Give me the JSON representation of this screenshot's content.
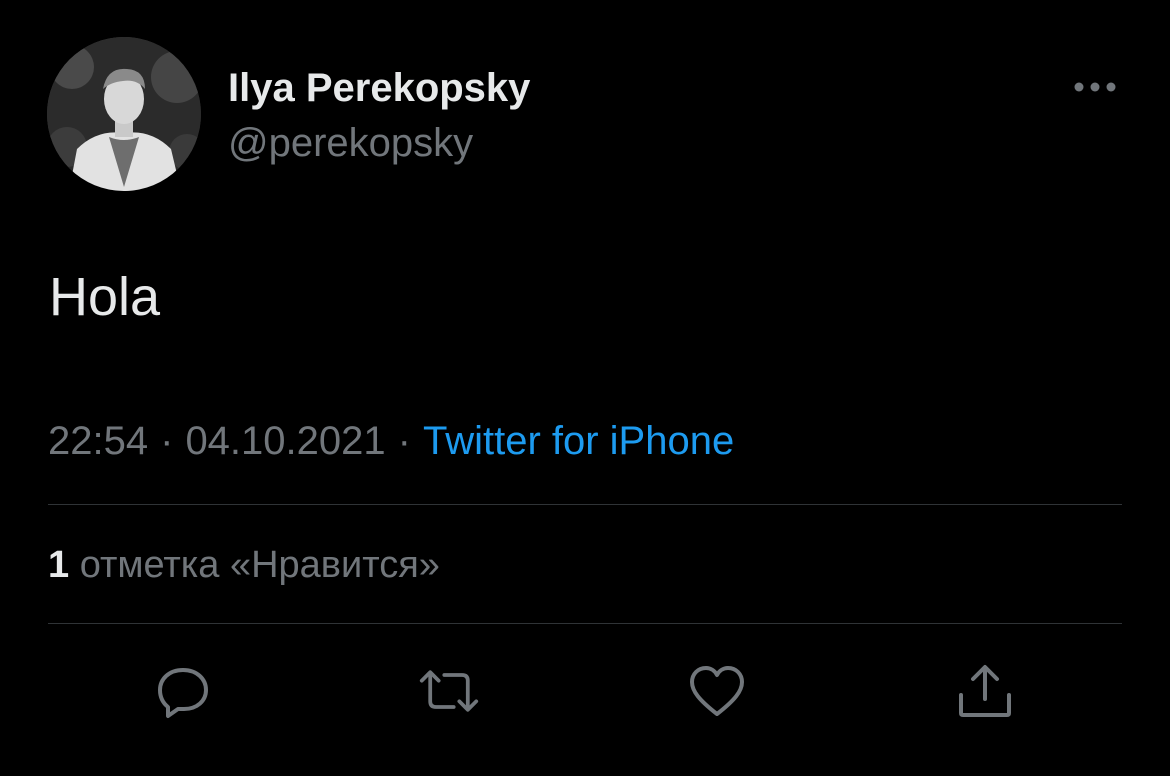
{
  "author": {
    "name": "Ilya Perekopsky",
    "handle": "@perekopsky"
  },
  "tweet": {
    "text": "Hola",
    "time": "22:54",
    "date": "04.10.2021",
    "separator": "·",
    "source": "Twitter for iPhone"
  },
  "stats": {
    "likes_count": "1",
    "likes_label": "отметка «Нравится»"
  },
  "icons": {
    "more": "more-horizontal-icon",
    "reply": "reply-icon",
    "retweet": "retweet-icon",
    "like": "heart-icon",
    "share": "share-icon"
  },
  "colors": {
    "background": "#000000",
    "primary_text": "#e7e9ea",
    "secondary_text": "#71767b",
    "link": "#1d9bf0",
    "divider": "#2f3336"
  }
}
